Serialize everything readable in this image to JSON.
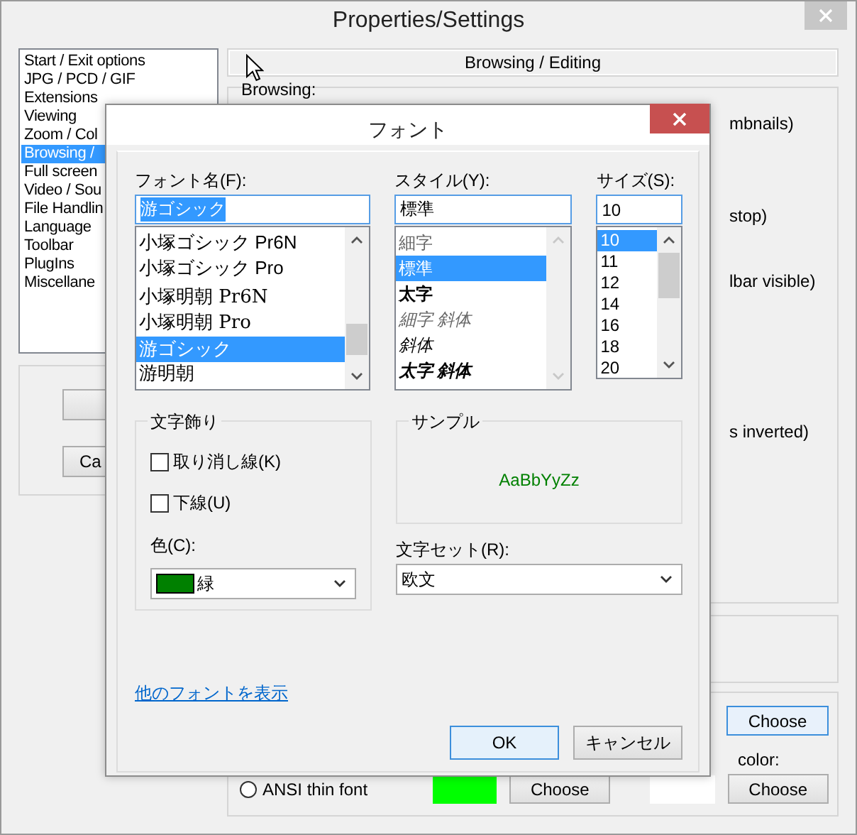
{
  "window": {
    "title": "Properties/Settings"
  },
  "sidebar": {
    "items": [
      {
        "label": "Start / Exit options",
        "selected": false
      },
      {
        "label": "JPG / PCD / GIF",
        "selected": false
      },
      {
        "label": "Extensions",
        "selected": false
      },
      {
        "label": "Viewing",
        "selected": false
      },
      {
        "label": "Zoom / Col",
        "selected": false
      },
      {
        "label": "Browsing /",
        "selected": true
      },
      {
        "label": "Full screen",
        "selected": false
      },
      {
        "label": "Video / Sou",
        "selected": false
      },
      {
        "label": "File Handlin",
        "selected": false
      },
      {
        "label": "Language",
        "selected": false
      },
      {
        "label": "Toolbar",
        "selected": false
      },
      {
        "label": "PlugIns",
        "selected": false
      },
      {
        "label": "Miscellane",
        "selected": false
      }
    ],
    "buttons": [
      "Ca"
    ]
  },
  "panel": {
    "header": "Browsing / Editing",
    "group_label": "Browsing:",
    "fragments": [
      "mbnails)",
      "stop)",
      "lbar visible)",
      "s inverted)"
    ],
    "choose_button": "Choose",
    "color_label": "color:",
    "radio": {
      "label": "ANSI thin font",
      "selected": false
    },
    "swatches": [
      {
        "color": "#00ff00",
        "button": "Choose"
      },
      {
        "color": "#ffffff",
        "button": "Choose"
      }
    ]
  },
  "dialog": {
    "title": "フォント",
    "font_name": {
      "label": "フォント名(F):",
      "value": "游ゴシック",
      "items": [
        {
          "label": "小塚ゴシック Pr6N",
          "kind": "sans",
          "selected": false
        },
        {
          "label": "小塚ゴシック Pro",
          "kind": "sans",
          "selected": false
        },
        {
          "label": "小塚明朝 Pr6N",
          "kind": "serif",
          "selected": false
        },
        {
          "label": "小塚明朝 Pro",
          "kind": "serif",
          "selected": false
        },
        {
          "label": "游ゴシック",
          "kind": "sans",
          "selected": true
        },
        {
          "label": "游明朝",
          "kind": "serif",
          "selected": false
        }
      ]
    },
    "style": {
      "label": "スタイル(Y):",
      "value": "標準",
      "items": [
        {
          "label": "細字",
          "kind": "light",
          "selected": false
        },
        {
          "label": "標準",
          "kind": "regular",
          "selected": true
        },
        {
          "label": "太字",
          "kind": "bold",
          "selected": false
        },
        {
          "label": "細字 斜体",
          "kind": "light-italic",
          "selected": false
        },
        {
          "label": "斜体",
          "kind": "italic",
          "selected": false
        },
        {
          "label": "太字 斜体",
          "kind": "bold-italic",
          "selected": false
        }
      ]
    },
    "size": {
      "label": "サイズ(S):",
      "value": "10",
      "items": [
        {
          "label": "10",
          "selected": true
        },
        {
          "label": "11",
          "selected": false
        },
        {
          "label": "12",
          "selected": false
        },
        {
          "label": "14",
          "selected": false
        },
        {
          "label": "16",
          "selected": false
        },
        {
          "label": "18",
          "selected": false
        },
        {
          "label": "20",
          "selected": false
        }
      ]
    },
    "effects": {
      "label": "文字飾り",
      "checkboxes": [
        {
          "label": "取り消し線(K)",
          "checked": false
        },
        {
          "label": "下線(U)",
          "checked": false
        }
      ],
      "color_label": "色(C):",
      "color": {
        "label": "緑",
        "color": "#008000"
      }
    },
    "sample": {
      "label": "サンプル",
      "text": "AaBbYyZz"
    },
    "charset": {
      "label": "文字セット(R):",
      "value": "欧文"
    },
    "link": "他のフォントを表示",
    "buttons": [
      {
        "label": "OK",
        "default": true
      },
      {
        "label": "キャンセル",
        "default": false
      }
    ]
  }
}
